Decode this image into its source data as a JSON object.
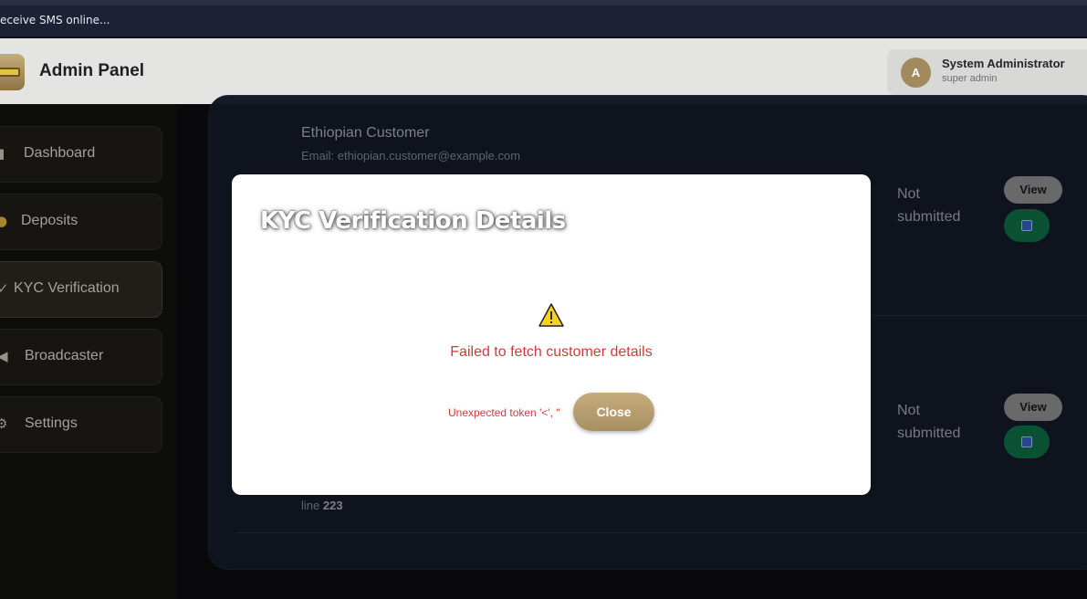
{
  "browser": {
    "bookmark": "eceive SMS online..."
  },
  "header": {
    "title": "Admin Panel",
    "user": {
      "initial": "A",
      "name": "System Administrator",
      "role": "super admin"
    }
  },
  "sidebar": {
    "items": [
      {
        "label": "Dashboard",
        "icon": "chart-icon"
      },
      {
        "label": "Deposits",
        "icon": "money-bag-icon"
      },
      {
        "label": "KYC Verification",
        "icon": "check-icon",
        "active": true
      },
      {
        "label": "Broadcaster",
        "icon": "megaphone-icon"
      },
      {
        "label": "Settings",
        "icon": "gear-icon"
      }
    ]
  },
  "customers": [
    {
      "name": "Ethiopian Customer",
      "email": "Email: ethiopian.customer@example.com",
      "status": "Not submitted",
      "view_label": "View"
    },
    {
      "status": "Not submitted",
      "view_label": "View",
      "line_prefix": "line",
      "line_number": "223"
    }
  ],
  "modal": {
    "title": "KYC Verification Details",
    "error_main": "Failed to fetch customer details",
    "error_detail": "Unexpected token '<', \"",
    "close_label": "Close"
  },
  "colors": {
    "accent": "#b39a6c",
    "error": "#d23a3a",
    "green": "#0f6e47"
  }
}
